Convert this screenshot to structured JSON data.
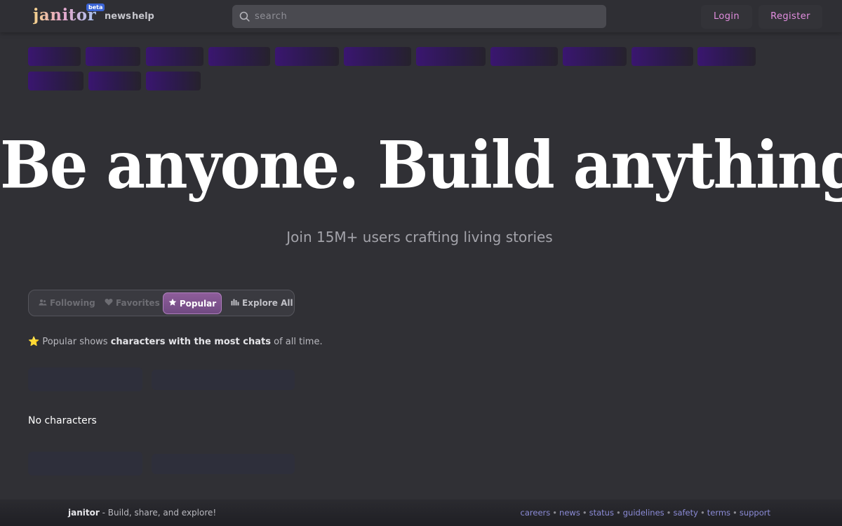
{
  "header": {
    "logo": "janitor",
    "beta": "beta",
    "nav": {
      "news": "news",
      "help": "help"
    },
    "search": {
      "placeholder": "search",
      "value": ""
    },
    "login_label": "Login",
    "register_label": "Register"
  },
  "hero": {
    "title": "Be anyone. Build anything.",
    "subtitle": "Join 15M+ users crafting living stories"
  },
  "tabs": {
    "items": [
      {
        "label": "Following",
        "icon": "users-icon",
        "active": false
      },
      {
        "label": "Favorites",
        "icon": "heart-icon",
        "active": false
      },
      {
        "label": "Popular",
        "icon": "star-icon",
        "active": true
      },
      {
        "label": "Explore All",
        "icon": "bar-chart-icon",
        "active": false
      }
    ]
  },
  "popular_note": {
    "emoji": "⭐",
    "pre": "Popular shows",
    "highlight": "characters with the most chats",
    "post": "of all time."
  },
  "empty_message": "No characters",
  "footer": {
    "brand": "janitor",
    "tagline": "- Build, share, and explore!",
    "links": [
      "careers",
      "news",
      "status",
      "guidelines",
      "safety",
      "terms",
      "support"
    ]
  },
  "colors": {
    "background": "#303035",
    "accent_pink": "#e38ee0",
    "tab_active": "#8e5d9a",
    "footer_link": "#8b8bd6",
    "skeleton_tag": "#3a1670"
  }
}
